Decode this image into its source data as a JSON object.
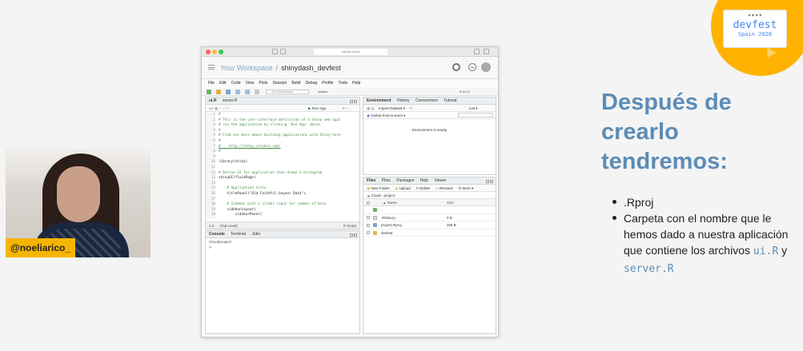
{
  "badge": {
    "title": "devfest",
    "subtitle": "Spain 2020"
  },
  "webcam": {
    "name_tag": "@noeliarico_"
  },
  "browser": {
    "url": "rstudio.cloud"
  },
  "rstudio": {
    "breadcrumb_workspace": "Your Workspace",
    "breadcrumb_separator": "/",
    "project_name": "shinydash_devfest",
    "menu": [
      "File",
      "Edit",
      "Code",
      "View",
      "Plots",
      "Session",
      "Build",
      "Debug",
      "Profile",
      "Tools",
      "Help"
    ],
    "toolbar": {
      "goto_placeholder": "Go to file/function",
      "addins_label": "Addins",
      "r_version": "R 4.0.2"
    },
    "editor": {
      "tabs": [
        "ui.R",
        "server.R"
      ],
      "run_app_label": "Run App",
      "lines": [
        {
          "n": "1",
          "text": "#",
          "kind": "comment"
        },
        {
          "n": "2",
          "text": "# This is the user-interface definition of a Shiny web appl",
          "kind": "comment"
        },
        {
          "n": "3",
          "text": "# run the application by clicking 'Run App' above.",
          "kind": "comment"
        },
        {
          "n": "4",
          "text": "#",
          "kind": "comment"
        },
        {
          "n": "5",
          "text": "# Find out more about building applications with Shiny here",
          "kind": "comment"
        },
        {
          "n": "6",
          "text": "#",
          "kind": "comment"
        },
        {
          "n": "7",
          "text": "#    http://shiny.rstudio.com/",
          "kind": "link"
        },
        {
          "n": "8",
          "text": "#",
          "kind": "comment"
        },
        {
          "n": "9",
          "text": "",
          "kind": "code"
        },
        {
          "n": "10",
          "text": "library(shiny)",
          "kind": "code"
        },
        {
          "n": "11",
          "text": "",
          "kind": "code"
        },
        {
          "n": "12",
          "text": "# Define UI for application that draws a histogram",
          "kind": "comment"
        },
        {
          "n": "13",
          "text": "shinyUI(fluidPage(",
          "kind": "code"
        },
        {
          "n": "14",
          "text": "",
          "kind": "code"
        },
        {
          "n": "15",
          "text": "    # Application title",
          "kind": "comment"
        },
        {
          "n": "16",
          "text": "    titlePanel(\"Old Faithful Geyser Data\"),",
          "kind": "code"
        },
        {
          "n": "17",
          "text": "",
          "kind": "code"
        },
        {
          "n": "18",
          "text": "    # Sidebar with a slider input for number of bins",
          "kind": "comment"
        },
        {
          "n": "19",
          "text": "    sidebarLayout(",
          "kind": "code"
        },
        {
          "n": "20",
          "text": "        sidebarPanel(",
          "kind": "code"
        }
      ],
      "status_left": "1:1",
      "status_scope": "(Top Level)",
      "status_right": "R Script"
    },
    "console": {
      "tabs": [
        "Console",
        "Terminal",
        "Jobs"
      ],
      "path": "/cloud/project/",
      "prompt": ">"
    },
    "environment": {
      "tabs": [
        "Environment",
        "History",
        "Connections",
        "Tutorial"
      ],
      "import_label": "Import Dataset",
      "list_label": "List",
      "scope_label": "Global Environment",
      "empty_message": "Environment is empty"
    },
    "files": {
      "tabs": [
        "Files",
        "Plots",
        "Packages",
        "Help",
        "Viewer"
      ],
      "actions": [
        "New Folder",
        "Upload",
        "Delete",
        "Rename",
        "More"
      ],
      "breadcrumb": [
        "Cloud",
        "project"
      ],
      "col_name": "Name",
      "col_size": "Size",
      "rows": [
        {
          "name": "..",
          "size": ""
        },
        {
          "name": ".Rhistory",
          "size": "0 B"
        },
        {
          "name": "project.Rproj",
          "size": "205 B"
        },
        {
          "name": "devfest",
          "size": ""
        }
      ]
    }
  },
  "slide": {
    "title_line1": "Después de",
    "title_line2": "crearlo",
    "title_line3": "tendremos:",
    "bullet1": ".Rproj",
    "bullet2_text": "Carpeta con el nombre que le hemos dado a nuestra aplicación que contiene los archivos",
    "bullet2_file1": "ui.R",
    "bullet2_conj": "y",
    "bullet2_file2": "server.R"
  },
  "colors": {
    "badge": "#ffb300",
    "slide_title": "#5d8cb6",
    "name_tag": "#f5b400"
  }
}
